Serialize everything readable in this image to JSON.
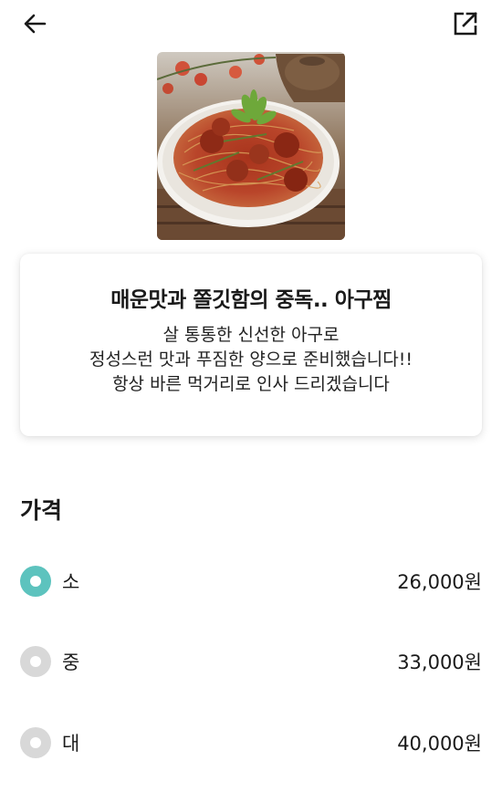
{
  "menu": {
    "title": "매운맛과 쫄깃함의 중독.. 아구찜",
    "description_lines": [
      "살 통통한 신선한 아구로",
      "정성스런 맛과 푸짐한 양으로 준비했습니다!!",
      "항상 바른 먹거리로 인사 드리겠습니다"
    ]
  },
  "price_section": {
    "title": "가격",
    "options": [
      {
        "size": "소",
        "price": "26,000원",
        "selected": true
      },
      {
        "size": "중",
        "price": "33,000원",
        "selected": false
      },
      {
        "size": "대",
        "price": "40,000원",
        "selected": false
      }
    ]
  },
  "icons": {
    "back": "arrow-left-icon",
    "share": "external-link-icon"
  },
  "colors": {
    "accent": "#5dc3be",
    "radio_off": "#d8d8d8"
  }
}
